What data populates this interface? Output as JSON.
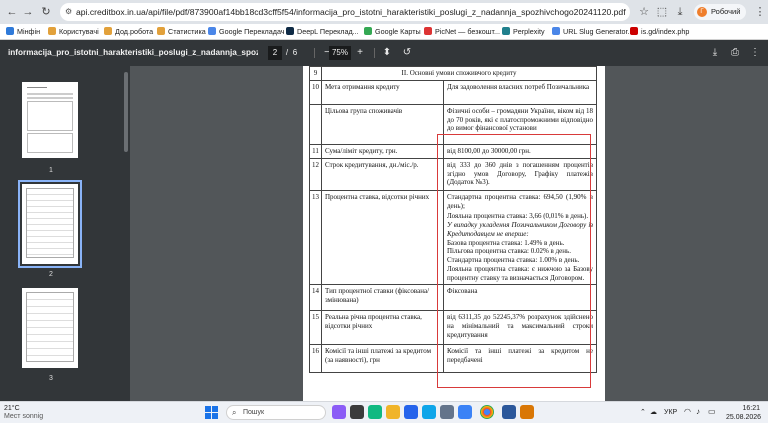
{
  "browser": {
    "url": "api.creditbox.in.ua/api/file/pdf/873900af14bb18cd3cff5f54/informacija_pro_istotni_harakteristiki_poslugi_z_nadannja_spozhivchogo20241120.pdf",
    "profile_label": "Робочий",
    "profile_initial": "Г",
    "bookmarks": [
      {
        "label": "Мінфін",
        "color": "#2f7ad9"
      },
      {
        "label": "Користувачі",
        "color": "#e2a13b"
      },
      {
        "label": "Дод.робота",
        "color": "#e2a13b"
      },
      {
        "label": "Статистика",
        "color": "#e2a13b"
      },
      {
        "label": "Google Перекладач",
        "color": "#4a86e8"
      },
      {
        "label": "DeepL Переклад...",
        "color": "#0f2b46"
      },
      {
        "label": "Google Карты",
        "color": "#34a853"
      },
      {
        "label": "PicNet — безкошт...",
        "color": "#d33"
      },
      {
        "label": "Perplexity",
        "color": "#20808d"
      },
      {
        "label": "URL Slug Generator...",
        "color": "#4a86e8"
      },
      {
        "label": "is.gd/index.php",
        "color": "#c00"
      }
    ]
  },
  "pdf": {
    "title": "informacija_pro_istotni_harakteristiki_poslugi_z_nadannja_spozhivchogo20...",
    "current_page": "2",
    "page_sep": "/",
    "total_pages": "6",
    "zoom": "75%",
    "thumbs": [
      {
        "num": "1"
      },
      {
        "num": "2"
      },
      {
        "num": "3"
      }
    ]
  },
  "doc": {
    "section_num": "9",
    "section_title": "ІІ. Основні умови споживчого кредиту",
    "rows": [
      {
        "n": "10",
        "label": "Мета отримання кредиту",
        "value": "Для задоволення власних потреб Позичальника"
      },
      {
        "n": "",
        "label": "Цільова група споживачів",
        "value": "Фізичні особи – громадяни України, віком від 18 до 70 років, які є платоспроможними відповідно до вимог фінансової установи"
      },
      {
        "n": "11",
        "label": "Сума/ліміт кредиту, грн.",
        "value": "від 8100,00 до 30000,00 грн."
      },
      {
        "n": "12",
        "label": "Строк кредитування, дн./міс./р.",
        "value": "від 333 до 360 днів з погашенням процентів згідно умов Договору, Графіку платежів (Додаток №3)."
      }
    ],
    "row13": {
      "n": "13",
      "label": "Процентна ставка, відсотки річних",
      "p1": "Стандартна процентна ставка: 694,50 (1,90% в день);",
      "p2": "Лояльна процентна ставка: 3,66 (0,01% в день).",
      "p3": "У випадку укладення Позичальником Договору із Кредитодавцем не вперше:",
      "p4": "Базова процентна ставка: 1.49% в день.",
      "p5": "Пільгова процентна ставка: 0.02% в день.",
      "p6": "Стандартна процентна ставка: 1.00% в день.",
      "p7": "Лояльна процентна ставка: є нижчою за Базову процентну ставку та визначається Договором."
    },
    "rows2": [
      {
        "n": "14",
        "label": "Тип процентної ставки (фіксована/змінювана)",
        "value": "Фіксована"
      },
      {
        "n": "15",
        "label": "Реальна річна процентна ставка, відсотки річних",
        "value": "від 6311,35 до 52245,37% розрахунок здійснено на мінімальний та максимальний строки кредитування"
      },
      {
        "n": "16",
        "label": "Комісії та інші платежі за кредитом (за наявності), грн",
        "value": "Комісії та інші платежі за кредитом не передбачені"
      }
    ]
  },
  "taskbar": {
    "weather_temp": "21°C",
    "weather_desc": "Мест sonnig",
    "search_placeholder": "Пошук",
    "lang": "УКР",
    "time": "16:21",
    "date": "25.08.2026"
  }
}
